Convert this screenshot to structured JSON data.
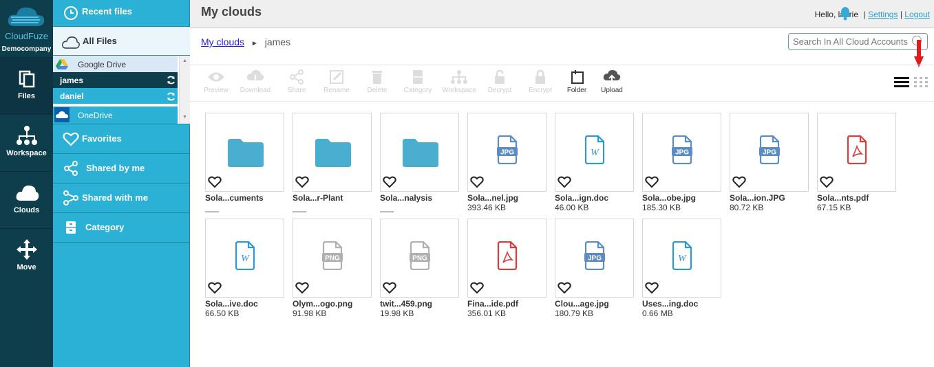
{
  "rail": {
    "brand": "CloudFuze",
    "company": "Democompany",
    "items": [
      {
        "label": "Files",
        "icon": "files-icon"
      },
      {
        "label": "Workspace",
        "icon": "workspace-icon"
      },
      {
        "label": "Clouds",
        "icon": "clouds-icon"
      },
      {
        "label": "Move",
        "icon": "move-icon"
      }
    ]
  },
  "sidebar": {
    "recent": "Recent files",
    "all_files": "All Files",
    "clouds": [
      {
        "label": "Google Drive",
        "icon": "google-drive-icon"
      },
      {
        "label": "james"
      },
      {
        "label": "daniel"
      },
      {
        "label": "OneDrive",
        "icon": "onedrive-icon"
      }
    ],
    "favorites": "Favorites",
    "shared_by_me": "Shared by me",
    "shared_with_me": "Shared with me",
    "category": "Category"
  },
  "header": {
    "title": "My clouds",
    "greeting": "Hello, laurie",
    "settings": "Settings",
    "logout": "Logout",
    "separator": "|"
  },
  "breadcrumb": {
    "root": "My clouds",
    "sep": "►",
    "current": "james"
  },
  "search": {
    "placeholder": "Search In All Cloud Accounts"
  },
  "toolbar": [
    {
      "label": "Preview",
      "icon": "eye-icon",
      "enabled": false
    },
    {
      "label": "Download",
      "icon": "download-icon",
      "enabled": false
    },
    {
      "label": "Share",
      "icon": "share-icon",
      "enabled": false
    },
    {
      "label": "Rename",
      "icon": "rename-icon",
      "enabled": false
    },
    {
      "label": "Delete",
      "icon": "trash-icon",
      "enabled": false
    },
    {
      "label": "Category",
      "icon": "category-icon",
      "enabled": false
    },
    {
      "label": "Workspace",
      "icon": "workspace-icon",
      "enabled": false
    },
    {
      "label": "Decrypt",
      "icon": "unlock-icon",
      "enabled": false
    },
    {
      "label": "Encrypt",
      "icon": "lock-icon",
      "enabled": false
    },
    {
      "label": "Folder",
      "icon": "new-folder-icon",
      "enabled": true
    },
    {
      "label": "Upload",
      "icon": "upload-icon",
      "enabled": true
    }
  ],
  "files": [
    {
      "name": "Sola...cuments",
      "size": "___",
      "type": "folder"
    },
    {
      "name": "Sola...r-Plant",
      "size": "___",
      "type": "folder"
    },
    {
      "name": "Sola...nalysis",
      "size": "___",
      "type": "folder"
    },
    {
      "name": "Sola...nel.jpg",
      "size": "393.46 KB",
      "type": "jpg"
    },
    {
      "name": "Sola...ign.doc",
      "size": "46.00 KB",
      "type": "doc"
    },
    {
      "name": "Sola...obe.jpg",
      "size": "185.30 KB",
      "type": "jpg"
    },
    {
      "name": "Sola...ion.JPG",
      "size": "80.72 KB",
      "type": "jpg"
    },
    {
      "name": "Sola...nts.pdf",
      "size": "67.15 KB",
      "type": "pdf"
    },
    {
      "name": "Sola...ive.doc",
      "size": "66.50 KB",
      "type": "doc"
    },
    {
      "name": "Olym...ogo.png",
      "size": "91.98 KB",
      "type": "png"
    },
    {
      "name": "twit...459.png",
      "size": "19.98 KB",
      "type": "png"
    },
    {
      "name": "Fina...ide.pdf",
      "size": "356.01 KB",
      "type": "pdf"
    },
    {
      "name": "Clou...age.jpg",
      "size": "180.79 KB",
      "type": "jpg"
    },
    {
      "name": "Uses...ing.doc",
      "size": "0.66 MB",
      "type": "doc"
    }
  ],
  "colors": {
    "rail": "#0e3d4c",
    "sidebar": "#2bb0d6",
    "folder": "#4aaed1",
    "jpg": "#5b8cc4",
    "doc": "#2f97d8",
    "pdf": "#e03b3b",
    "png": "#b0b0b0",
    "arrow": "#e01b1b"
  }
}
